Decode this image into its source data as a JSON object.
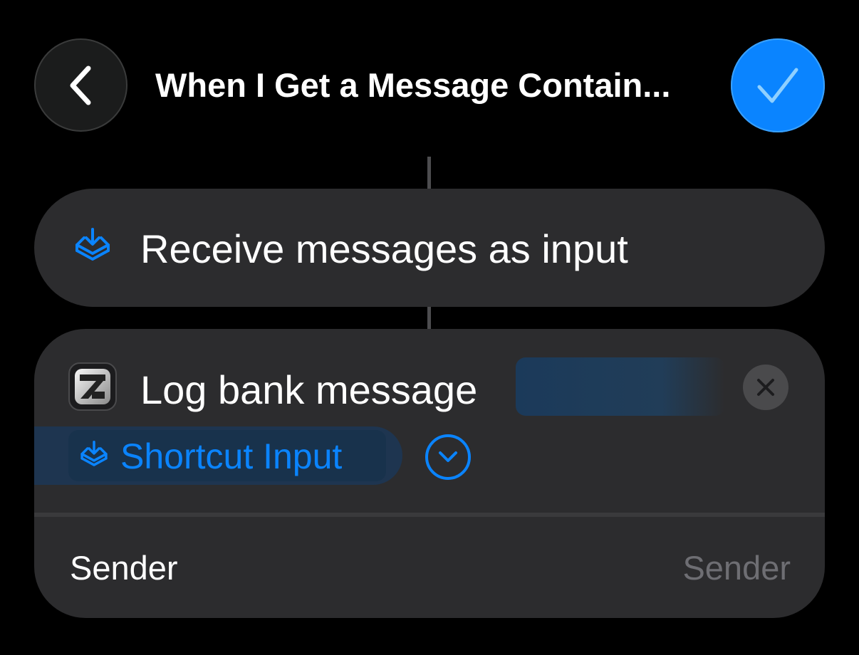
{
  "header": {
    "back_icon": "chevron-left-icon",
    "title": "When I Get a Message Contain...",
    "done_icon": "checkmark-icon"
  },
  "actions": [
    {
      "icon": "tray-download-icon",
      "label": "Receive messages as input"
    },
    {
      "icon": "app-icon",
      "label": "Log bank message",
      "remove_icon": "close-icon",
      "input_token": {
        "icon": "tray-download-icon",
        "label": "Shortcut Input"
      },
      "expand_icon": "chevron-down-circle-icon",
      "parameters": [
        {
          "label": "Sender",
          "placeholder": "Sender"
        }
      ]
    }
  ],
  "colors": {
    "accent": "#0a84ff",
    "background": "#000000",
    "card": "#2c2c2e",
    "secondary_text": "#6e6e73"
  }
}
